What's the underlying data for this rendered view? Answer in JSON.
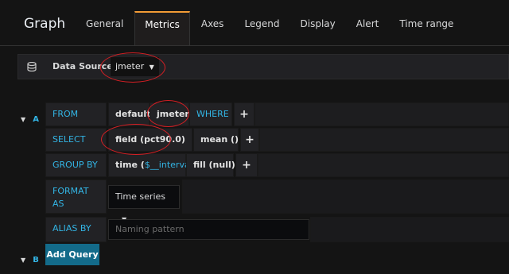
{
  "header": {
    "title": "Graph",
    "tabs": [
      "General",
      "Metrics",
      "Axes",
      "Legend",
      "Display",
      "Alert",
      "Time range"
    ],
    "active_tab": "Metrics"
  },
  "datasource": {
    "label": "Data Source",
    "value": "jmeter"
  },
  "query_a": {
    "letter": "A",
    "from": {
      "label": "FROM",
      "policy": "default",
      "measurement": "jmeter",
      "where": "WHERE"
    },
    "select": {
      "label": "SELECT",
      "field": "field (pct90.0)",
      "aggregation": "mean ()"
    },
    "group_by": {
      "label": "GROUP BY",
      "time_prefix": "time (",
      "time_var": "$__interval",
      "time_suffix": ")",
      "fill": "fill (null)"
    },
    "format_as": {
      "label_line1": "FORMAT",
      "label_line2": "AS",
      "value": "Time series"
    },
    "alias_by": {
      "label": "ALIAS BY",
      "placeholder": "Naming pattern"
    }
  },
  "query_b": {
    "letter": "B",
    "add_query_label": "Add Query"
  },
  "colors": {
    "accent_blue": "#33b5e5",
    "active_tab_orange": "#f29b35",
    "annotation_red": "#d71f24",
    "add_query_bg": "#136b8a"
  }
}
